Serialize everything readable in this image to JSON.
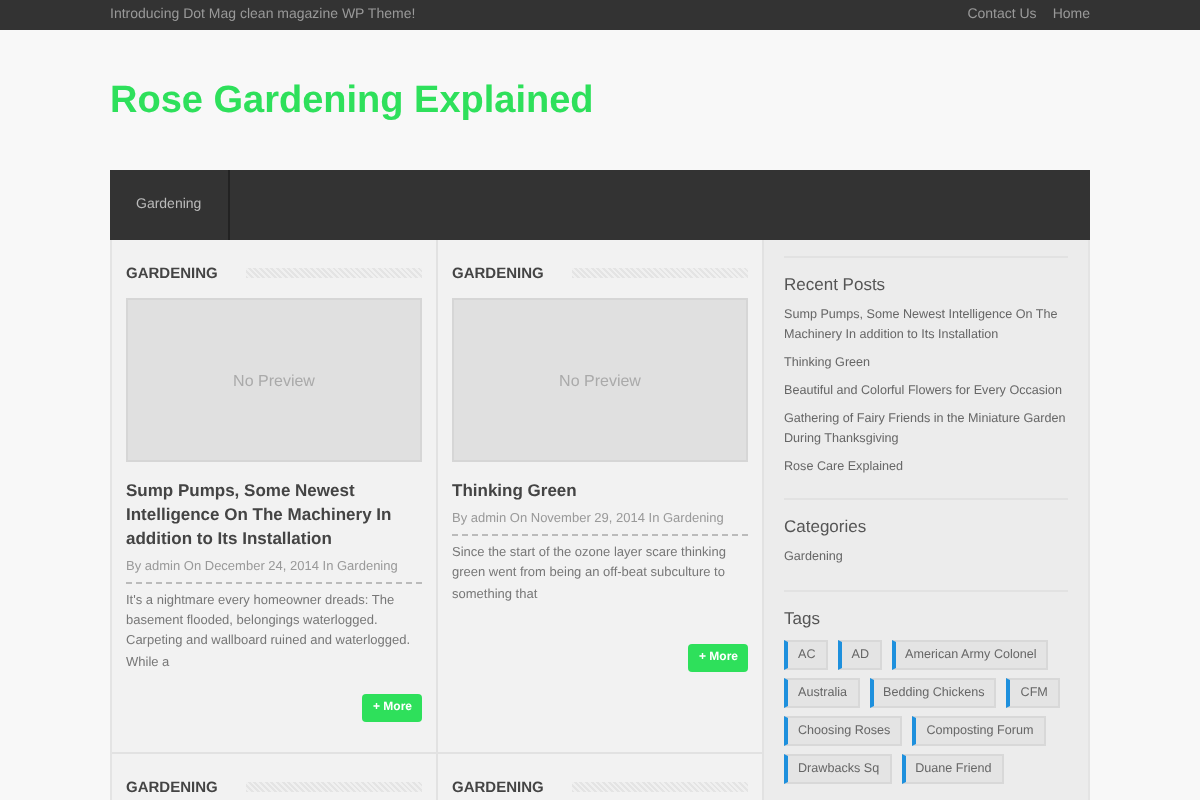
{
  "top_bar": {
    "tagline": "Introducing Dot Mag clean magazine WP Theme!",
    "links": [
      "Contact Us",
      "Home"
    ]
  },
  "site_title": "Rose Gardening Explained",
  "nav": {
    "items": [
      {
        "label": "Gardening"
      }
    ]
  },
  "posts": [
    {
      "category": "GARDENING",
      "preview": "No Preview",
      "title": "Sump Pumps, Some Newest Intelligence On The Machinery In addition to Its Installation",
      "meta": "By admin On December 24, 2014 In Gardening",
      "excerpt": "It's a nightmare every homeowner dreads: The basement flooded, belongings waterlogged. Carpeting and wallboard ruined and waterlogged. While a",
      "more": "+ More"
    },
    {
      "category": "GARDENING",
      "preview": "No Preview",
      "title": "Thinking Green",
      "meta": "By admin On November 29, 2014 In Gardening",
      "excerpt": "Since the start of the ozone layer scare thinking green went from being an off-beat subculture to something that",
      "more": "+ More"
    },
    {
      "category": "GARDENING"
    },
    {
      "category": "GARDENING"
    }
  ],
  "sidebar": {
    "recent_posts": {
      "title": "Recent Posts",
      "items": [
        "Sump Pumps, Some Newest Intelligence On The Machinery In addition to Its Installation",
        "Thinking Green",
        "Beautiful and Colorful Flowers for Every Occasion",
        "Gathering of Fairy Friends in the Miniature Garden During Thanksgiving",
        "Rose Care Explained"
      ]
    },
    "categories": {
      "title": "Categories",
      "items": [
        "Gardening"
      ]
    },
    "tags": {
      "title": "Tags",
      "items": [
        "AC",
        "AD",
        "American Army Colonel",
        "Australia",
        "Bedding Chickens",
        "CFM",
        "Choosing Roses",
        "Composting Forum",
        "Drawbacks Sq",
        "Duane Friend"
      ]
    }
  }
}
